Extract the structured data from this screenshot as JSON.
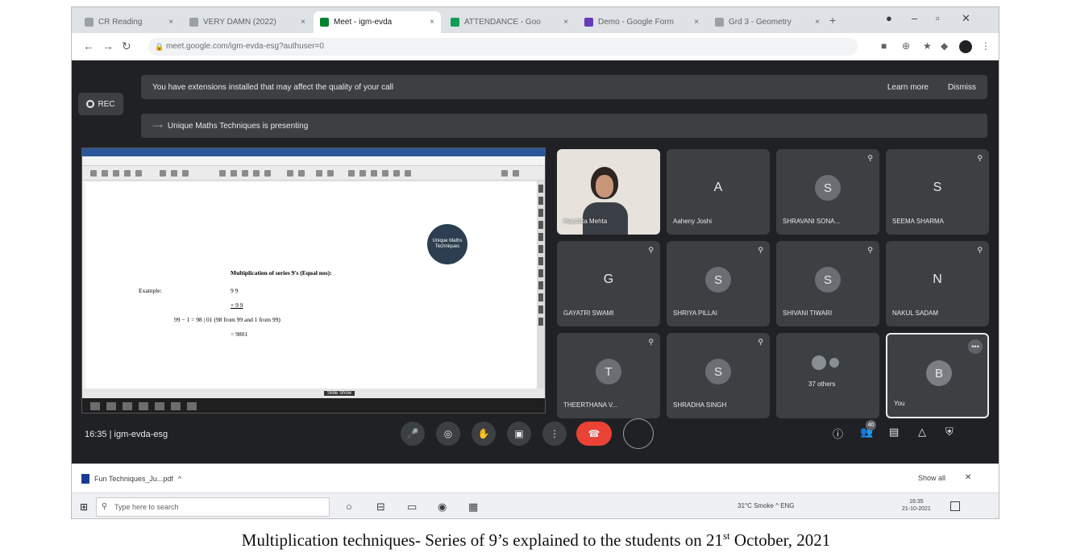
{
  "browser": {
    "tabs": [
      {
        "label": "CR Reading"
      },
      {
        "label": "VERY DAMN (2022)"
      },
      {
        "label": "Meet - igm-evda"
      },
      {
        "label": "ATTENDANCE - Goo"
      },
      {
        "label": "Demo - Google Form"
      },
      {
        "label": "Grd 3 - Geometry"
      }
    ],
    "new_tab": "+",
    "url": "meet.google.com/igm-evda-esg?authuser=0"
  },
  "meet": {
    "rec_label": "REC",
    "extension_notice": "You have extensions installed that may affect the quality of your call",
    "learn_more": "Learn more",
    "dismiss": "Dismiss",
    "presenting_notice": "Unique Maths Techniques is presenting",
    "clock": "16:35",
    "meeting_code": "igm-evda-esg",
    "people_badge": "40"
  },
  "presentation": {
    "logo_text": "Unique Maths Techniques",
    "title": "Multiplication of series 9's (Equal nos):",
    "example_label": "Example:",
    "line1": "9 9",
    "line2": "× 9 9",
    "line3": "99 − 1 = 98 | 01 (98 from 99 and 1 from 99)",
    "line4": "= 9801",
    "status_highlight": "Slide Show"
  },
  "participants": [
    {
      "name": "Harshita Mehta",
      "initial": "",
      "video": true
    },
    {
      "name": "Aaheny Joshi",
      "initial": "A"
    },
    {
      "name": "SHRAVANI SONA...",
      "initial": "S"
    },
    {
      "name": "SEEMA SHARMA",
      "initial": "S"
    },
    {
      "name": "GAYATRI SWAMI",
      "initial": "G"
    },
    {
      "name": "SHRIYA PILLAI",
      "initial": "S"
    },
    {
      "name": "SHIVANI TIWARI",
      "initial": "S"
    },
    {
      "name": "NAKUL SADAM",
      "initial": "N"
    },
    {
      "name": "THEERTHANA V...",
      "initial": "T"
    },
    {
      "name": "SHRADHA SINGH",
      "initial": "S"
    },
    {
      "name": "37 others",
      "initial": ""
    },
    {
      "name": "You",
      "initial": "B"
    }
  ],
  "downloads": {
    "file": "Fun Techniques_Ju...pdf",
    "show_all": "Show all"
  },
  "taskbar": {
    "search_placeholder": "Type here to search",
    "tray_text": "31°C Smoke  ^  ENG",
    "time": "16:35",
    "date": "21-10-2021"
  },
  "caption": {
    "before": "Multiplication techniques- Series of 9’s explained to the students on 21",
    "sup": "st",
    "after": " October, 2021"
  }
}
